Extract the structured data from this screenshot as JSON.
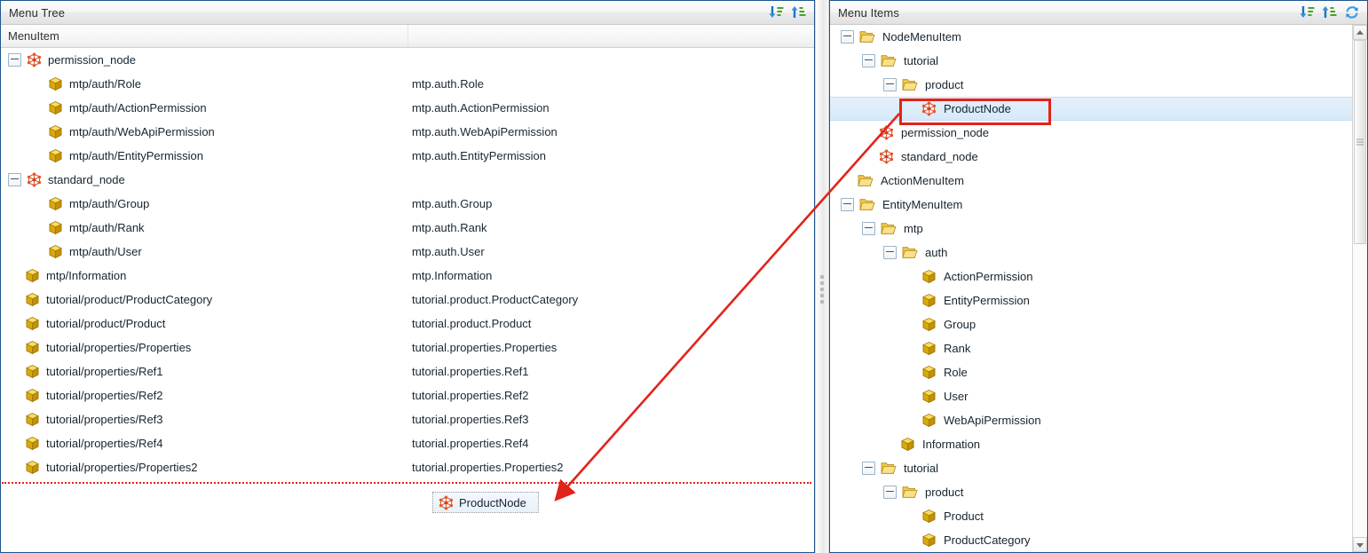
{
  "left_panel": {
    "header_title": "Menu Tree",
    "tools": [
      {
        "name": "sort-descending-icon",
        "label": "Sort Descending"
      },
      {
        "name": "sort-ascending-icon",
        "label": "Sort Ascending"
      }
    ],
    "columns": [
      "MenuItem",
      ""
    ],
    "rows": [
      {
        "indent": 0,
        "expander": "minus",
        "icon": "node-icon",
        "name": "permission_node",
        "value": ""
      },
      {
        "indent": 1,
        "expander": "none",
        "icon": "cube-icon",
        "name": "mtp/auth/Role",
        "value": "mtp.auth.Role"
      },
      {
        "indent": 1,
        "expander": "none",
        "icon": "cube-icon",
        "name": "mtp/auth/ActionPermission",
        "value": "mtp.auth.ActionPermission"
      },
      {
        "indent": 1,
        "expander": "none",
        "icon": "cube-icon",
        "name": "mtp/auth/WebApiPermission",
        "value": "mtp.auth.WebApiPermission"
      },
      {
        "indent": 1,
        "expander": "none",
        "icon": "cube-icon",
        "name": "mtp/auth/EntityPermission",
        "value": "mtp.auth.EntityPermission"
      },
      {
        "indent": 0,
        "expander": "minus",
        "icon": "node-icon",
        "name": "standard_node",
        "value": ""
      },
      {
        "indent": 1,
        "expander": "none",
        "icon": "cube-icon",
        "name": "mtp/auth/Group",
        "value": "mtp.auth.Group"
      },
      {
        "indent": 1,
        "expander": "none",
        "icon": "cube-icon",
        "name": "mtp/auth/Rank",
        "value": "mtp.auth.Rank"
      },
      {
        "indent": 1,
        "expander": "none",
        "icon": "cube-icon",
        "name": "mtp/auth/User",
        "value": "mtp.auth.User"
      },
      {
        "indent": 0,
        "expander": "none",
        "icon": "cube-icon",
        "name": "mtp/Information",
        "value": "mtp.Information"
      },
      {
        "indent": 0,
        "expander": "none",
        "icon": "cube-icon",
        "name": "tutorial/product/ProductCategory",
        "value": "tutorial.product.ProductCategory"
      },
      {
        "indent": 0,
        "expander": "none",
        "icon": "cube-icon",
        "name": "tutorial/product/Product",
        "value": "tutorial.product.Product"
      },
      {
        "indent": 0,
        "expander": "none",
        "icon": "cube-icon",
        "name": "tutorial/properties/Properties",
        "value": "tutorial.properties.Properties"
      },
      {
        "indent": 0,
        "expander": "none",
        "icon": "cube-icon",
        "name": "tutorial/properties/Ref1",
        "value": "tutorial.properties.Ref1"
      },
      {
        "indent": 0,
        "expander": "none",
        "icon": "cube-icon",
        "name": "tutorial/properties/Ref2",
        "value": "tutorial.properties.Ref2"
      },
      {
        "indent": 0,
        "expander": "none",
        "icon": "cube-icon",
        "name": "tutorial/properties/Ref3",
        "value": "tutorial.properties.Ref3"
      },
      {
        "indent": 0,
        "expander": "none",
        "icon": "cube-icon",
        "name": "tutorial/properties/Ref4",
        "value": "tutorial.properties.Ref4"
      },
      {
        "indent": 0,
        "expander": "none",
        "icon": "cube-icon",
        "name": "tutorial/properties/Properties2",
        "value": "tutorial.properties.Properties2"
      }
    ]
  },
  "right_panel": {
    "header_title": "Menu Items",
    "tools": [
      {
        "name": "sort-descending-icon",
        "label": "Sort Descending"
      },
      {
        "name": "sort-ascending-icon",
        "label": "Sort Ascending"
      },
      {
        "name": "refresh-icon",
        "label": "Refresh"
      }
    ],
    "rows": [
      {
        "indent": 0,
        "expander": "minus",
        "icon": "folder-icon",
        "name": "NodeMenuItem",
        "selected": false
      },
      {
        "indent": 1,
        "expander": "minus",
        "icon": "folder-icon",
        "name": "tutorial",
        "selected": false
      },
      {
        "indent": 2,
        "expander": "minus",
        "icon": "folder-icon",
        "name": "product",
        "selected": false
      },
      {
        "indent": 3,
        "expander": "none",
        "icon": "node-icon",
        "name": "ProductNode",
        "selected": true
      },
      {
        "indent": 1,
        "expander": "none",
        "icon": "node-icon",
        "name": "permission_node",
        "selected": false
      },
      {
        "indent": 1,
        "expander": "none",
        "icon": "node-icon",
        "name": "standard_node",
        "selected": false
      },
      {
        "indent": 0,
        "expander": "none",
        "icon": "folder-icon",
        "name": "ActionMenuItem",
        "selected": false
      },
      {
        "indent": 0,
        "expander": "minus",
        "icon": "folder-icon",
        "name": "EntityMenuItem",
        "selected": false
      },
      {
        "indent": 1,
        "expander": "minus",
        "icon": "folder-icon",
        "name": "mtp",
        "selected": false
      },
      {
        "indent": 2,
        "expander": "minus",
        "icon": "folder-icon",
        "name": "auth",
        "selected": false
      },
      {
        "indent": 3,
        "expander": "none",
        "icon": "cube-icon",
        "name": "ActionPermission",
        "selected": false
      },
      {
        "indent": 3,
        "expander": "none",
        "icon": "cube-icon",
        "name": "EntityPermission",
        "selected": false
      },
      {
        "indent": 3,
        "expander": "none",
        "icon": "cube-icon",
        "name": "Group",
        "selected": false
      },
      {
        "indent": 3,
        "expander": "none",
        "icon": "cube-icon",
        "name": "Rank",
        "selected": false
      },
      {
        "indent": 3,
        "expander": "none",
        "icon": "cube-icon",
        "name": "Role",
        "selected": false
      },
      {
        "indent": 3,
        "expander": "none",
        "icon": "cube-icon",
        "name": "User",
        "selected": false
      },
      {
        "indent": 3,
        "expander": "none",
        "icon": "cube-icon",
        "name": "WebApiPermission",
        "selected": false
      },
      {
        "indent": 2,
        "expander": "none",
        "icon": "cube-icon",
        "name": "Information",
        "selected": false
      },
      {
        "indent": 1,
        "expander": "minus",
        "icon": "folder-icon",
        "name": "tutorial",
        "selected": false
      },
      {
        "indent": 2,
        "expander": "minus",
        "icon": "folder-icon",
        "name": "product",
        "selected": false
      },
      {
        "indent": 3,
        "expander": "none",
        "icon": "cube-icon",
        "name": "Product",
        "selected": false
      },
      {
        "indent": 3,
        "expander": "none",
        "icon": "cube-icon",
        "name": "ProductCategory",
        "selected": false
      }
    ]
  },
  "drag_ghost": {
    "label": "ProductNode",
    "icon": "node-icon"
  },
  "annotations": {
    "highlight_color": "#e2231a",
    "drop_indicator_color": "#e2231a",
    "arrow_label": ""
  }
}
